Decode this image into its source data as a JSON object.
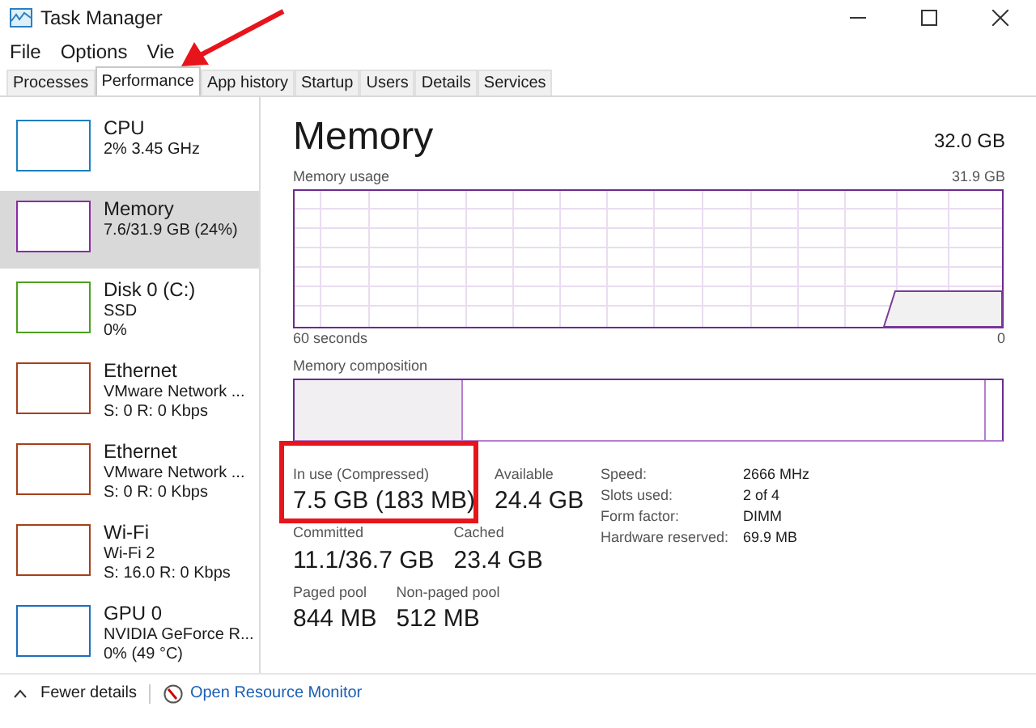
{
  "window": {
    "title": "Task Manager"
  },
  "menu": [
    "File",
    "Options",
    "Vie"
  ],
  "tabs": [
    {
      "label": "Processes",
      "selected": false
    },
    {
      "label": "Performance",
      "selected": true
    },
    {
      "label": "App history",
      "selected": false
    },
    {
      "label": "Startup",
      "selected": false
    },
    {
      "label": "Users",
      "selected": false
    },
    {
      "label": "Details",
      "selected": false
    },
    {
      "label": "Services",
      "selected": false
    }
  ],
  "sidebar": {
    "items": [
      {
        "name": "CPU",
        "lines": [
          "2%  3.45 GHz"
        ],
        "color": "#1b7fbd",
        "selected": false
      },
      {
        "name": "Memory",
        "lines": [
          "7.6/31.9 GB (24%)"
        ],
        "color": "#8b2aa6",
        "selected": true
      },
      {
        "name": "Disk 0 (C:)",
        "lines": [
          "SSD",
          "0%"
        ],
        "color": "#4da01f",
        "selected": false
      },
      {
        "name": "Ethernet",
        "lines": [
          "VMware Network ...",
          "S: 0 R: 0 Kbps"
        ],
        "color": "#a5401a",
        "selected": false
      },
      {
        "name": "Ethernet",
        "lines": [
          "VMware Network ...",
          "S: 0 R: 0 Kbps"
        ],
        "color": "#a5401a",
        "selected": false
      },
      {
        "name": "Wi-Fi",
        "lines": [
          "Wi-Fi 2",
          "S: 16.0 R: 0 Kbps"
        ],
        "color": "#a5401a",
        "selected": false
      },
      {
        "name": "GPU 0",
        "lines": [
          "NVIDIA GeForce R...",
          "0%  (49 °C)"
        ],
        "color": "#1b6fbd",
        "selected": false
      }
    ]
  },
  "panel": {
    "title": "Memory",
    "total": "32.0 GB",
    "usage_label": "Memory usage",
    "usage_max": "31.9 GB",
    "time_label": "60 seconds",
    "time_end": "0",
    "composition_label": "Memory composition",
    "stat_rows": [
      [
        {
          "label": "In use (Compressed)",
          "value": "7.5 GB (183 MB)"
        },
        {
          "label": "Available",
          "value": "24.4 GB"
        }
      ],
      [
        {
          "label": "Committed",
          "value": "11.1/36.7 GB"
        },
        {
          "label": "Cached",
          "value": "23.4 GB"
        }
      ],
      [
        {
          "label": "Paged pool",
          "value": "844 MB"
        },
        {
          "label": "Non-paged pool",
          "value": "512 MB"
        }
      ]
    ],
    "details": [
      {
        "key": "Speed:",
        "value": "2666 MHz"
      },
      {
        "key": "Slots used:",
        "value": "2 of 4"
      },
      {
        "key": "Form factor:",
        "value": "DIMM"
      },
      {
        "key": "Hardware reserved:",
        "value": "69.9 MB"
      }
    ]
  },
  "footer": {
    "fewer": "Fewer details",
    "link": "Open Resource Monitor"
  }
}
